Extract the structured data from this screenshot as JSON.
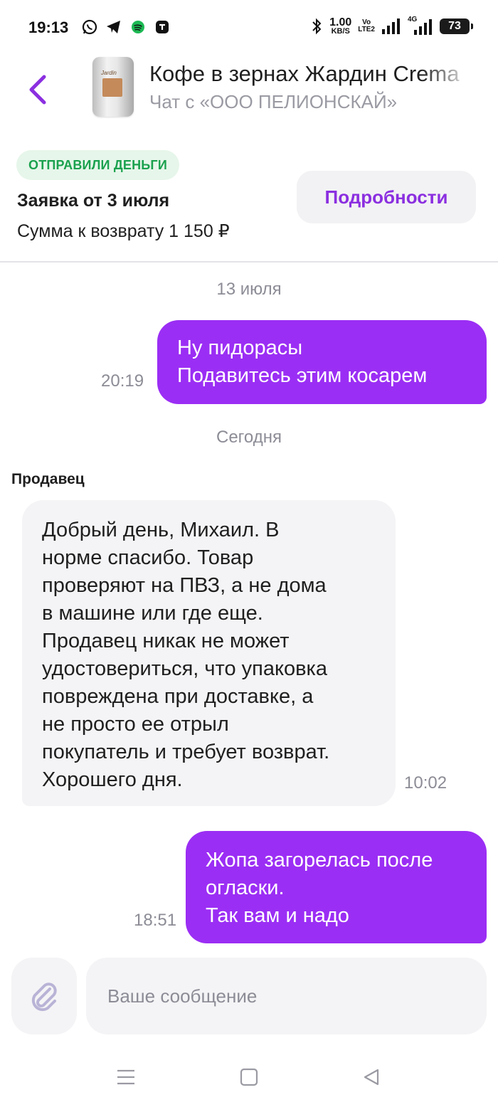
{
  "status_bar": {
    "time": "19:13",
    "net_speed_value": "1.00",
    "net_speed_unit": "KB/S",
    "volte_top": "Vo",
    "volte_bottom": "LTE2",
    "network_type": "4G",
    "battery": "73",
    "left_icons": [
      "whatsapp-icon",
      "telegram-icon",
      "spotify-icon",
      "app-icon"
    ],
    "right_icons": [
      "bluetooth-icon",
      "signal-icon",
      "signal-icon"
    ]
  },
  "header": {
    "title": "Кофе в зернах Жардин Crema",
    "subtitle": "Чат с «ООО ПЕЛИОНСКАЙ»",
    "product_brand": "Jardin"
  },
  "return_card": {
    "badge": "ОТПРАВИЛИ ДЕНЬГИ",
    "request_title": "Заявка от 3 июля",
    "refund_amount": "Сумма к возврату 1 150 ₽",
    "details_button": "Подробности"
  },
  "chat": {
    "date_1": "13 июля",
    "msg_1": {
      "lines": [
        "Ну пидорасы",
        "Подавитесь этим косарем"
      ],
      "time": "20:19"
    },
    "date_2": "Сегодня",
    "sender_label": "Продавец",
    "msg_2": {
      "lines": [
        "Добрый день, Михаил. В",
        "норме спасибо. Товар",
        "проверяют на ПВЗ, а не дома",
        "в машине или где еще.",
        "Продавец никак не может",
        "удостовериться, что упаковка",
        "повреждена при доставке, а",
        "не просто ее отрыл",
        "покупатель и требует возврат.",
        "Хорошего дня."
      ],
      "time": "10:02"
    },
    "msg_3": {
      "lines": [
        "Жопа загорелась после",
        "огласки.",
        "Так вам и надо"
      ],
      "time": "18:51"
    }
  },
  "input": {
    "placeholder": "Ваше сообщение"
  },
  "colors": {
    "accent": "#9b2ef4",
    "badge_text": "#1aa14e",
    "badge_bg": "#e6f6ea",
    "bubble_in_bg": "#f4f4f6"
  }
}
